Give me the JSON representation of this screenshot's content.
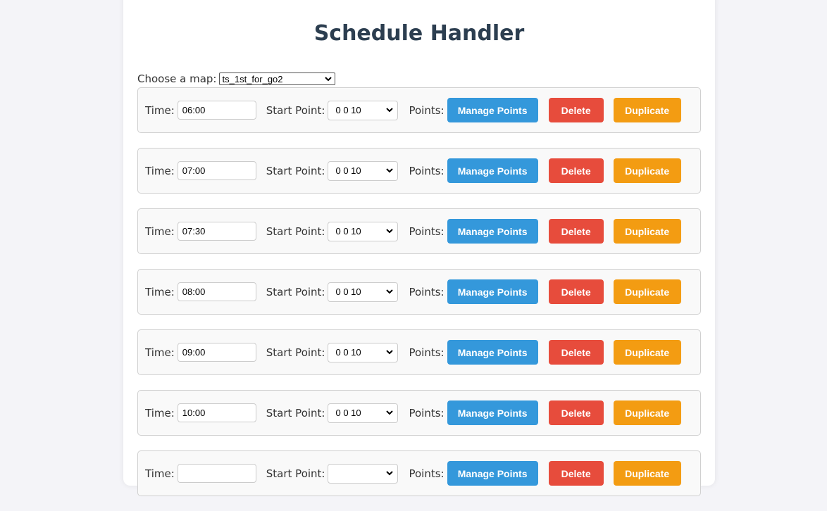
{
  "page": {
    "title": "Schedule Handler"
  },
  "map_selector": {
    "label": "Choose a map:",
    "selected": "ts_1st_for_go2"
  },
  "row_labels": {
    "time": "Time:",
    "start_point": "Start Point:",
    "points": "Points:",
    "manage_button": "Manage Points",
    "delete_button": "Delete",
    "duplicate_button": "Duplicate"
  },
  "colors": {
    "title": "#2c3e50",
    "manage": "#3498db",
    "delete": "#e74c3c",
    "duplicate": "#f39c12"
  },
  "schedules": [
    {
      "time": "06:00",
      "start_point": "0 0 10"
    },
    {
      "time": "07:00",
      "start_point": "0 0 10"
    },
    {
      "time": "07:30",
      "start_point": "0 0 10"
    },
    {
      "time": "08:00",
      "start_point": "0 0 10"
    },
    {
      "time": "09:00",
      "start_point": "0 0 10"
    },
    {
      "time": "10:00",
      "start_point": "0 0 10"
    },
    {
      "time": "",
      "start_point": ""
    }
  ]
}
